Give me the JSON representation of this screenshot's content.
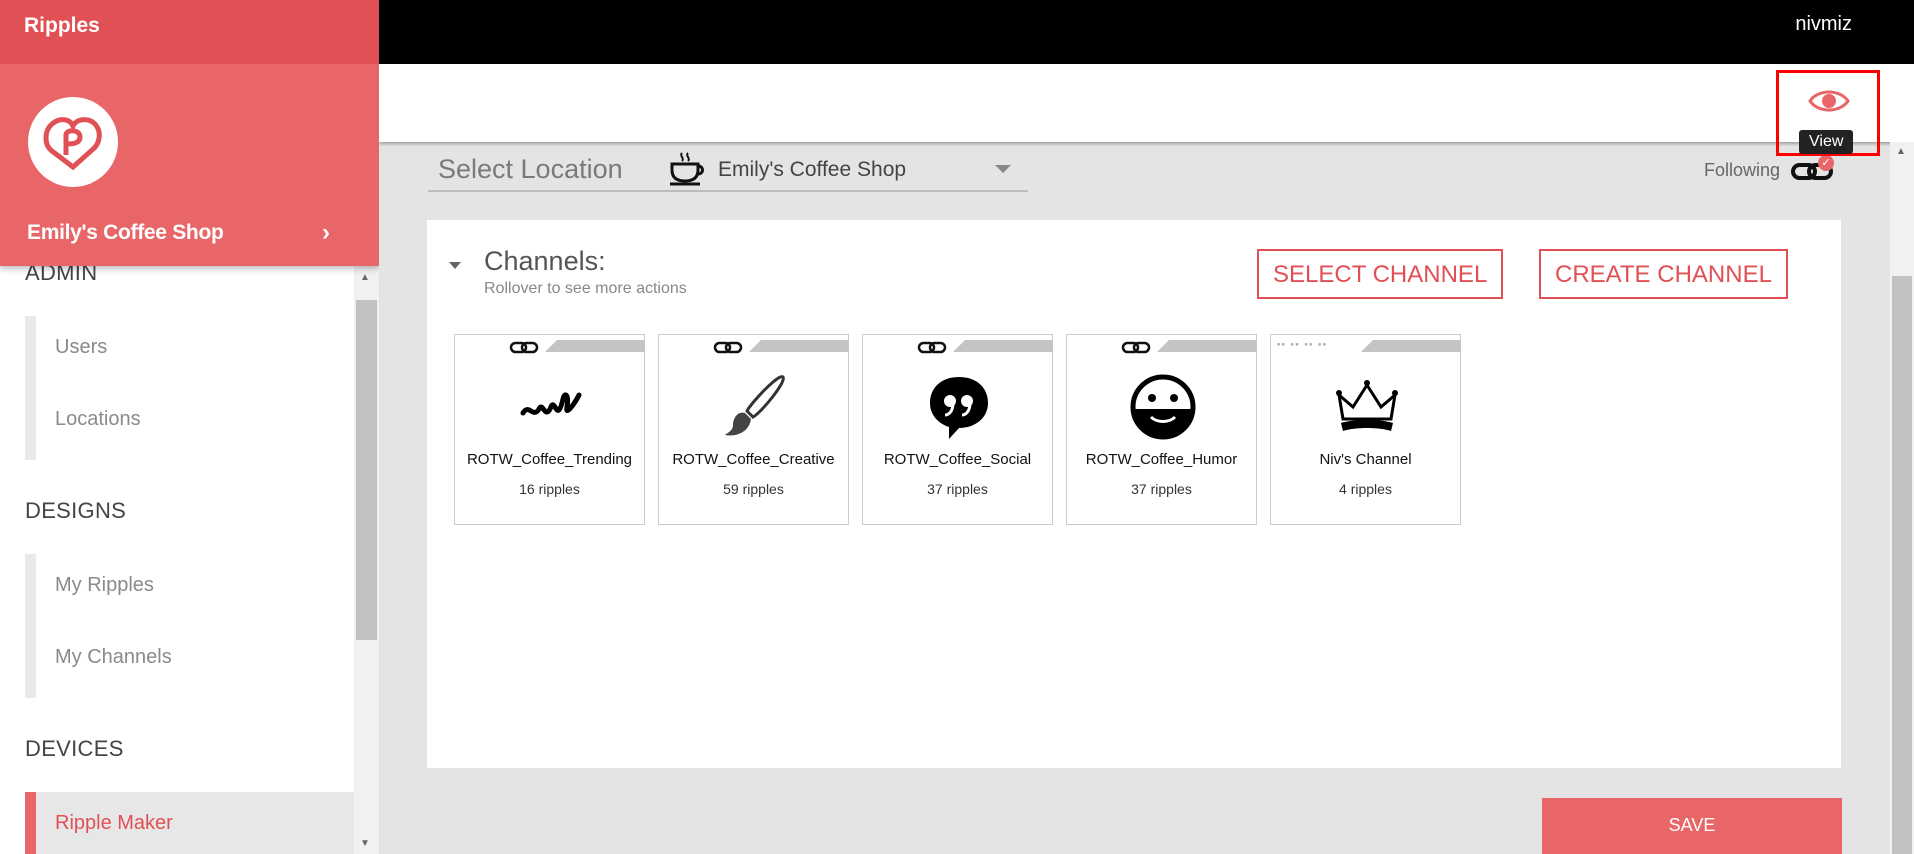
{
  "app": {
    "name": "Ripples",
    "user": "nivmiz"
  },
  "sidebar": {
    "location_name": "Emily's Coffee Shop",
    "sections": {
      "admin": "ADMIN",
      "designs": "DESIGNS",
      "devices": "DEVICES"
    },
    "admin_items": [
      "Users",
      "Locations"
    ],
    "design_items": [
      "My Ripples",
      "My Channels"
    ],
    "active_item": "Ripple Maker"
  },
  "toolbar": {
    "view_tooltip": "View"
  },
  "location": {
    "label": "Select Location",
    "value": "Emily's Coffee Shop",
    "following_label": "Following"
  },
  "channels": {
    "title": "Channels:",
    "subtitle": "Rollover to see more actions",
    "select_button": "SELECT CHANNEL",
    "create_button": "CREATE CHANNEL",
    "items": [
      {
        "name": "ROTW_Coffee_Trending",
        "count": "16 ripples",
        "icon": "trending-scribble-icon"
      },
      {
        "name": "ROTW_Coffee_Creative",
        "count": "59 ripples",
        "icon": "paintbrush-icon"
      },
      {
        "name": "ROTW_Coffee_Social",
        "count": "37 ripples",
        "icon": "speech-quote-icon"
      },
      {
        "name": "ROTW_Coffee_Humor",
        "count": "37 ripples",
        "icon": "smiley-icon"
      },
      {
        "name": "Niv's Channel",
        "count": "4 ripples",
        "icon": "crown-icon"
      }
    ]
  },
  "footer": {
    "save_label": "SAVE"
  },
  "colors": {
    "accent": "#e96668",
    "accent_dark": "#e05055",
    "highlight": "#ff0000"
  }
}
